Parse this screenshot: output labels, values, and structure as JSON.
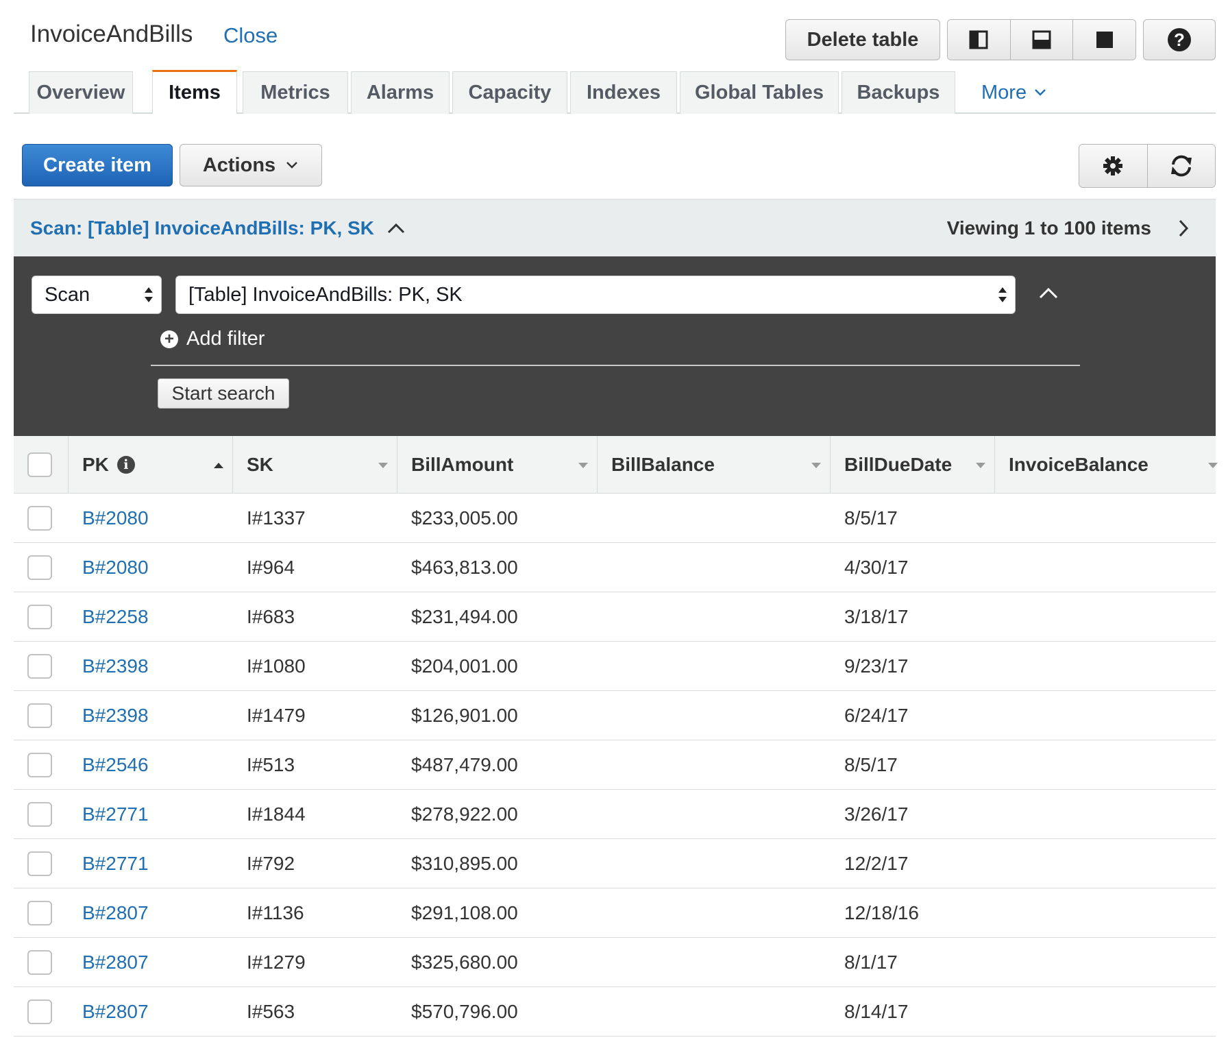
{
  "header": {
    "title": "InvoiceAndBills",
    "close_label": "Close",
    "delete_label": "Delete table",
    "layout_icons": [
      "split-vertical-icon",
      "split-horizontal-icon",
      "full-panel-icon"
    ],
    "help_label": "?"
  },
  "tabs": [
    {
      "label": "Overview"
    },
    {
      "label": "Items"
    },
    {
      "label": "Metrics"
    },
    {
      "label": "Alarms"
    },
    {
      "label": "Capacity"
    },
    {
      "label": "Indexes"
    },
    {
      "label": "Global Tables"
    },
    {
      "label": "Backups"
    }
  ],
  "tabs_more_label": "More",
  "active_tab": "Items",
  "toolbar": {
    "create_label": "Create item",
    "actions_label": "Actions"
  },
  "scan": {
    "title": "Scan: [Table] InvoiceAndBills: PK, SK",
    "viewing": "Viewing 1 to 100 items"
  },
  "filter": {
    "mode_value": "Scan",
    "target_value": "[Table] InvoiceAndBills: PK, SK",
    "add_filter_label": "Add filter",
    "start_search_label": "Start search"
  },
  "table": {
    "columns": [
      "PK",
      "SK",
      "BillAmount",
      "BillBalance",
      "BillDueDate",
      "InvoiceBalance"
    ],
    "rows": [
      {
        "pk": "B#2080",
        "sk": "I#1337",
        "amount": "$233,005.00",
        "balance": "",
        "due": "8/5/17",
        "invoice": ""
      },
      {
        "pk": "B#2080",
        "sk": "I#964",
        "amount": "$463,813.00",
        "balance": "",
        "due": "4/30/17",
        "invoice": ""
      },
      {
        "pk": "B#2258",
        "sk": "I#683",
        "amount": "$231,494.00",
        "balance": "",
        "due": "3/18/17",
        "invoice": ""
      },
      {
        "pk": "B#2398",
        "sk": "I#1080",
        "amount": "$204,001.00",
        "balance": "",
        "due": "9/23/17",
        "invoice": ""
      },
      {
        "pk": "B#2398",
        "sk": "I#1479",
        "amount": "$126,901.00",
        "balance": "",
        "due": "6/24/17",
        "invoice": ""
      },
      {
        "pk": "B#2546",
        "sk": "I#513",
        "amount": "$487,479.00",
        "balance": "",
        "due": "8/5/17",
        "invoice": ""
      },
      {
        "pk": "B#2771",
        "sk": "I#1844",
        "amount": "$278,922.00",
        "balance": "",
        "due": "3/26/17",
        "invoice": ""
      },
      {
        "pk": "B#2771",
        "sk": "I#792",
        "amount": "$310,895.00",
        "balance": "",
        "due": "12/2/17",
        "invoice": ""
      },
      {
        "pk": "B#2807",
        "sk": "I#1136",
        "amount": "$291,108.00",
        "balance": "",
        "due": "12/18/16",
        "invoice": ""
      },
      {
        "pk": "B#2807",
        "sk": "I#1279",
        "amount": "$325,680.00",
        "balance": "",
        "due": "8/1/17",
        "invoice": ""
      },
      {
        "pk": "B#2807",
        "sk": "I#563",
        "amount": "$570,796.00",
        "balance": "",
        "due": "8/14/17",
        "invoice": ""
      }
    ]
  },
  "colors": {
    "link": "#1f6fb2",
    "primary_button": "#1f63b5",
    "active_tab_accent": "#ec7211",
    "filter_panel": "#434343"
  }
}
